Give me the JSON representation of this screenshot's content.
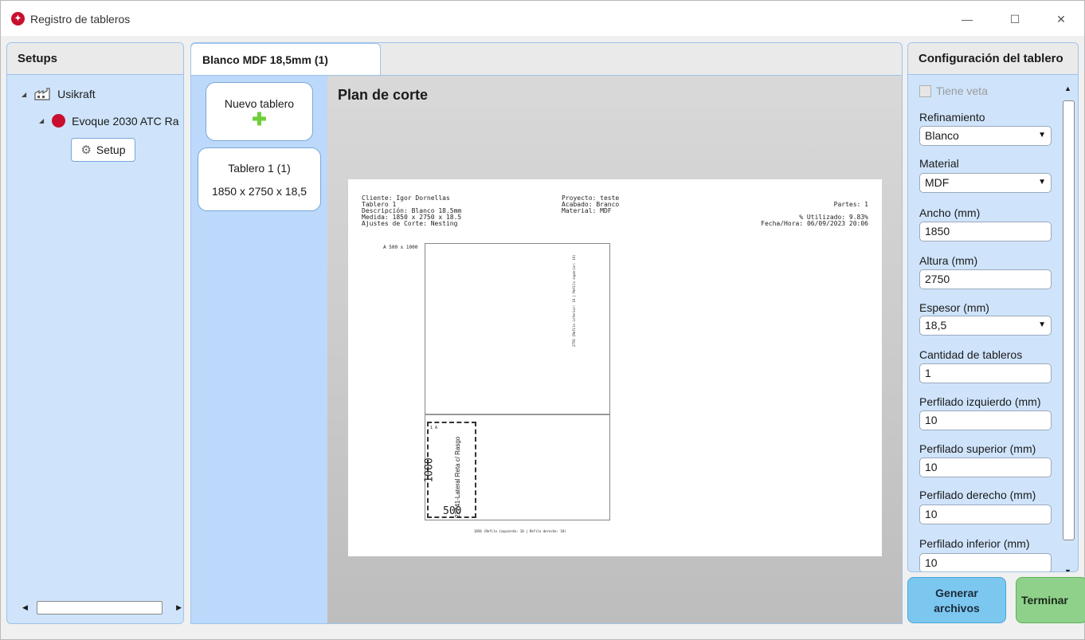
{
  "window": {
    "title": "Registro de tableros",
    "minimize": "—",
    "maximize": "☐",
    "close": "✕"
  },
  "setups": {
    "header": "Setups",
    "tree": {
      "root": "Usikraft",
      "machine": "Evoque 2030 ATC Ra",
      "setup": "Setup"
    }
  },
  "tab": {
    "label": "Blanco MDF 18,5mm (1)"
  },
  "boards": {
    "new_label": "Nuevo tablero",
    "items": [
      {
        "name": "Tablero 1 (1)",
        "dims": "1850 x 2750 x 18,5"
      }
    ]
  },
  "plan": {
    "title": "Plan de corte",
    "header_left": [
      "Cliente: Igor Dornellas",
      "Tablero 1",
      "Descripción: Blanco 18.5mm",
      "Medida: 1850 x 2750 x 18.5",
      "Ajustes de Corte: Nesting"
    ],
    "header_mid": [
      "Proyecto: teste",
      "Acabado: Branco",
      "Material: MDF"
    ],
    "header_right": [
      "Partes: 1",
      "% Utilizado: 9.83%",
      "Fecha/Hora: 06/09/2023 20:06"
    ],
    "remnant_label": "A   500 x 1000",
    "side_label": "2750 (Refilo inferior: 10 | Refilo superior: 10)",
    "bottom_label": "1850 (Refilo izquierdo: 10 | Refilo derecho: 10)",
    "part": {
      "id": "1 A",
      "name": "22741-Lateral Reta c/ Rasgo",
      "height": "1000",
      "width": "500"
    }
  },
  "config": {
    "header": "Configuración del tablero",
    "grain_label": "Tiene veta",
    "fields": [
      {
        "label": "Refinamiento",
        "value": "Blanco",
        "dropdown": true
      },
      {
        "label": "Material",
        "value": "MDF",
        "dropdown": true
      },
      {
        "label": "Ancho (mm)",
        "value": "1850",
        "dropdown": false
      },
      {
        "label": "Altura (mm)",
        "value": "2750",
        "dropdown": false
      },
      {
        "label": "Espesor (mm)",
        "value": "18,5",
        "dropdown": true
      },
      {
        "label": "Cantidad de tableros",
        "value": "1",
        "dropdown": false
      },
      {
        "label": "Perfilado izquierdo (mm)",
        "value": "10",
        "dropdown": false
      },
      {
        "label": "Perfilado superior (mm)",
        "value": "10",
        "dropdown": false
      },
      {
        "label": "Perfilado derecho (mm)",
        "value": "10",
        "dropdown": false
      },
      {
        "label": "Perfilado inferior (mm)",
        "value": "10",
        "dropdown": false
      }
    ]
  },
  "actions": {
    "generate": "Generar archivos",
    "finish": "Terminar"
  },
  "colors": {
    "brand": "#c8102e",
    "panel": "#cfe4fb",
    "generate": "#7cc7ef",
    "finish": "#8fd18a"
  }
}
